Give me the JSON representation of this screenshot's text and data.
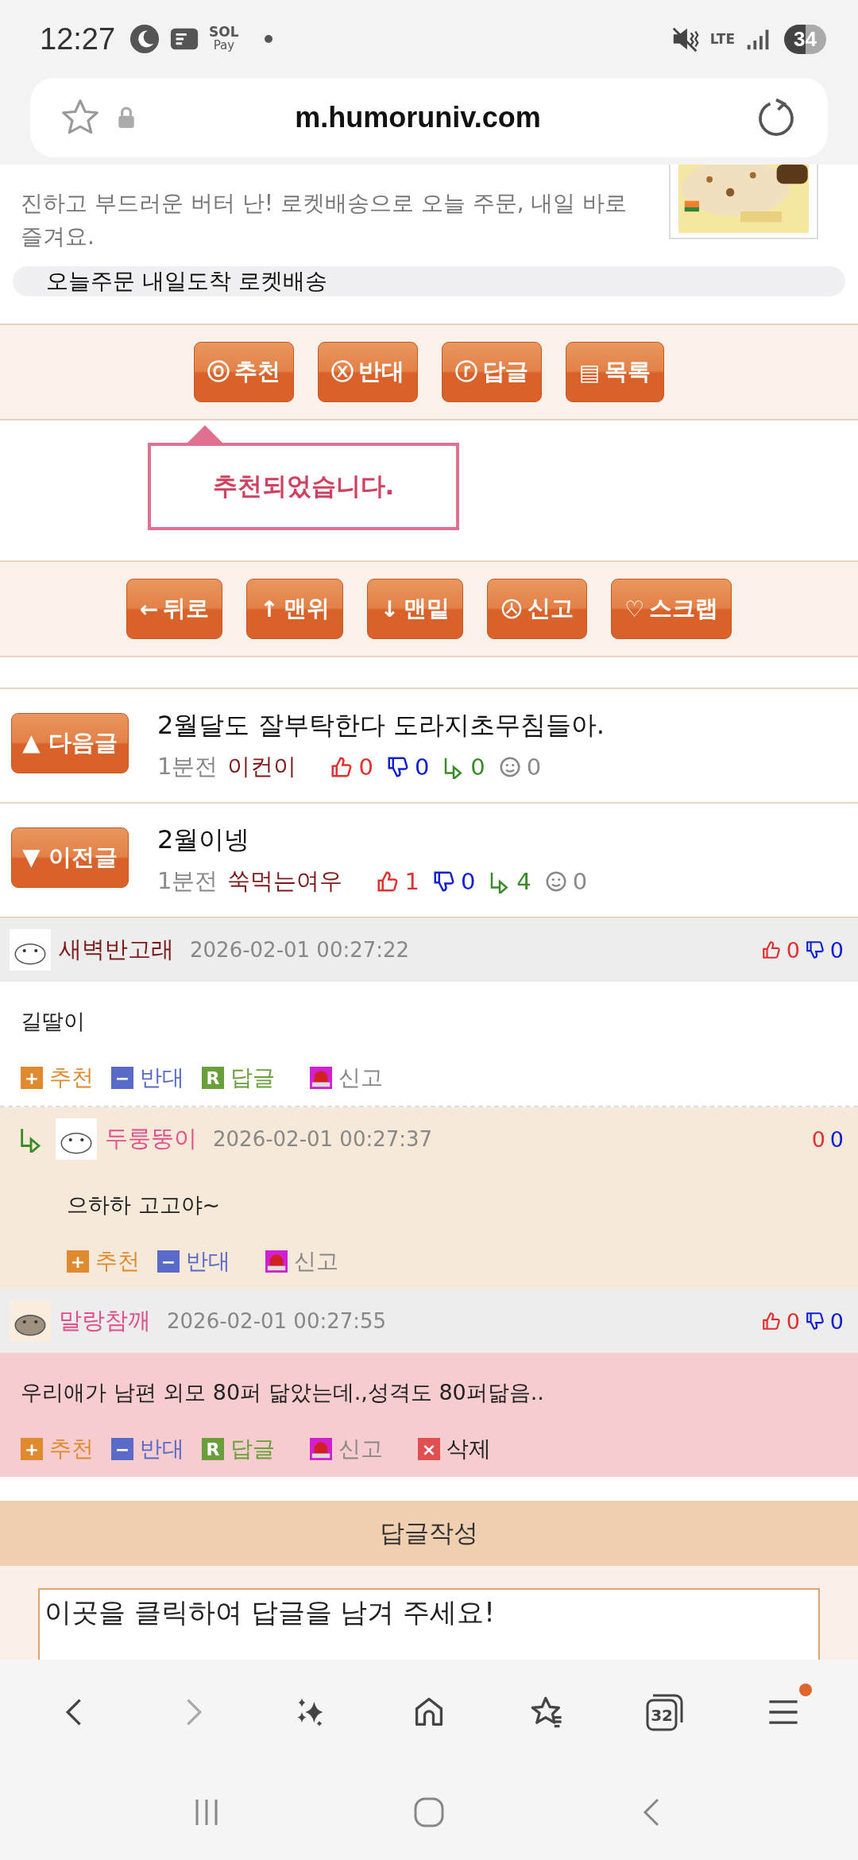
{
  "status_bar": {
    "time": "12:27",
    "pay_logo": {
      "top": "SOL",
      "bottom": "Pay"
    },
    "network": "LTE",
    "battery": "34"
  },
  "address_bar": {
    "url": "m.humoruniv.com"
  },
  "ad": {
    "description": "진하고 부드러운 버터 난! 로켓배송으로 오늘 주문, 내일 바로 즐겨요.",
    "chip": "오늘주문 내일도착 로켓배송"
  },
  "post_buttons": [
    {
      "symbol": "ⓞ",
      "label": "추천"
    },
    {
      "symbol": "ⓧ",
      "label": "반대"
    },
    {
      "symbol": "ⓡ",
      "label": "답글"
    },
    {
      "symbol": "▤",
      "label": "목록"
    }
  ],
  "toast": "추천되었습니다.",
  "nav_buttons": [
    {
      "symbol": "←",
      "label": "뒤로"
    },
    {
      "symbol": "↑",
      "label": "맨위"
    },
    {
      "symbol": "↓",
      "label": "맨밑"
    },
    {
      "kind": "report",
      "label": "신고"
    },
    {
      "symbol": "♡",
      "label": "스크랩"
    }
  ],
  "adjacent_posts": [
    {
      "button": "▲ 다음글",
      "title": "2월달도 잘부탁한다 도라지초무침들아.",
      "time": "1분전",
      "author": "이컨이",
      "up": "0",
      "down": "0",
      "replies": "0",
      "views": "0"
    },
    {
      "button": "▼ 이전글",
      "title": "2월이넹",
      "time": "1분전",
      "author": "쑥먹는여우",
      "up": "1",
      "down": "0",
      "replies": "4",
      "views": "0"
    }
  ],
  "comments": [
    {
      "kind": "comment",
      "author": "새벽반고래",
      "color": "#7a1a1a",
      "date": "2026-02-01 00:27:22",
      "up": "0",
      "down": "0",
      "text": "길딸이",
      "highlighted": false,
      "actions": [
        {
          "kind": "recommend",
          "symbol": "+",
          "label": "추천"
        },
        {
          "kind": "oppose",
          "symbol": "−",
          "label": "반대"
        },
        {
          "kind": "reply",
          "symbol": "R",
          "label": "답글"
        },
        {
          "kind": "report",
          "label": "신고"
        }
      ]
    },
    {
      "kind": "reply",
      "author": "두룽뚱이",
      "color": "#e0508a",
      "date": "2026-02-01 00:27:37",
      "up": "0",
      "down": "0",
      "text": "으하하 고고야~",
      "highlighted": false,
      "actions": [
        {
          "kind": "recommend",
          "symbol": "+",
          "label": "추천"
        },
        {
          "kind": "oppose",
          "symbol": "−",
          "label": "반대"
        },
        {
          "kind": "report",
          "label": "신고"
        }
      ]
    },
    {
      "kind": "comment",
      "author": "말랑참깨",
      "color": "#e0508a",
      "date": "2026-02-01 00:27:55",
      "up": "0",
      "down": "0",
      "text": "우리애가 남편 외모 80퍼 닮았는데.,성격도 80퍼닮음..",
      "highlighted": true,
      "actions": [
        {
          "kind": "recommend",
          "symbol": "+",
          "label": "추천"
        },
        {
          "kind": "oppose",
          "symbol": "−",
          "label": "반대"
        },
        {
          "kind": "reply",
          "symbol": "R",
          "label": "답글"
        },
        {
          "kind": "report",
          "label": "신고"
        },
        {
          "kind": "delete",
          "symbol": "×",
          "label": "삭제"
        }
      ]
    }
  ],
  "reply_form": {
    "title": "답글작성",
    "placeholder": "이곳을 클릭하여 답글을 남겨 주세요!"
  },
  "browser_nav": [
    {
      "kind": "back",
      "disabled": false
    },
    {
      "kind": "forward",
      "disabled": true
    },
    {
      "kind": "assistant",
      "disabled": false
    },
    {
      "kind": "home",
      "disabled": false
    },
    {
      "kind": "bookmarks",
      "disabled": false
    },
    {
      "kind": "tabs",
      "count": "32",
      "disabled": false
    },
    {
      "kind": "menu",
      "badge": true,
      "disabled": false
    }
  ]
}
